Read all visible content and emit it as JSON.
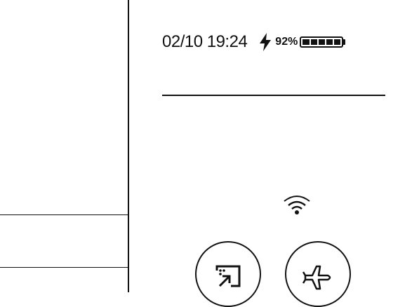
{
  "status_bar": {
    "datetime": "02/10 19:24",
    "charging_icon": "bolt-icon",
    "battery_percent": "92%",
    "battery_level": 0.92,
    "battery_icon": "battery-icon"
  },
  "wifi": {
    "icon": "wifi-icon"
  },
  "quick_toggles": [
    {
      "icon": "screen-cast-icon"
    },
    {
      "icon": "airplane-mode-icon"
    }
  ]
}
